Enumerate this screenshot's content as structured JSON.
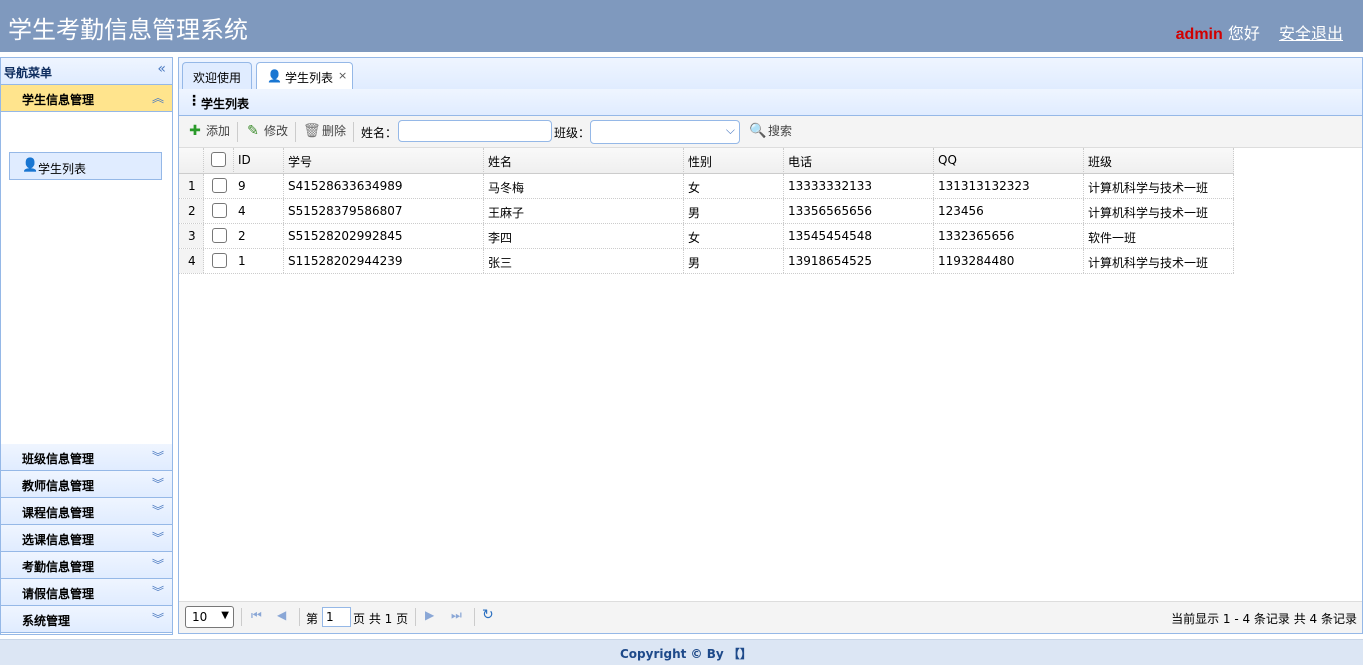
{
  "header": {
    "app_title": "学生考勤信息管理系统",
    "user_name": "admin",
    "greeting": "您好",
    "logout": "安全退出"
  },
  "sidebar": {
    "title": "导航菜单",
    "active_section": "学生信息管理",
    "active_items": [
      {
        "label": "学生列表",
        "icon": "user-icon"
      }
    ],
    "sections": [
      {
        "label": "班级信息管理"
      },
      {
        "label": "教师信息管理"
      },
      {
        "label": "课程信息管理"
      },
      {
        "label": "选课信息管理"
      },
      {
        "label": "考勤信息管理"
      },
      {
        "label": "请假信息管理"
      },
      {
        "label": "系统管理"
      }
    ]
  },
  "tabs": [
    {
      "label": "欢迎使用"
    },
    {
      "label": "学生列表",
      "close": "×"
    }
  ],
  "panel": {
    "title": "学生列表"
  },
  "toolbar": {
    "add": "添加",
    "edit": "修改",
    "delete": "删除",
    "name_label": "姓名：",
    "name_value": "",
    "class_label": "班级：",
    "class_value": "",
    "search": "搜索"
  },
  "table": {
    "columns": [
      "ID",
      "学号",
      "姓名",
      "性别",
      "电话",
      "QQ",
      "班级"
    ],
    "rows": [
      {
        "num": "1",
        "cells": [
          "9",
          "S41528633634989",
          "马冬梅",
          "女",
          "13333332133",
          "131313132323",
          "计算机科学与技术一班"
        ]
      },
      {
        "num": "2",
        "cells": [
          "4",
          "S51528379586807",
          "王麻子",
          "男",
          "13356565656",
          "123456",
          "计算机科学与技术一班"
        ]
      },
      {
        "num": "3",
        "cells": [
          "2",
          "S51528202992845",
          "李四",
          "女",
          "13545454548",
          "1332365656",
          "软件一班"
        ]
      },
      {
        "num": "4",
        "cells": [
          "1",
          "S11528202944239",
          "张三",
          "男",
          "13918654525",
          "1193284480",
          "计算机科学与技术一班"
        ]
      }
    ]
  },
  "pager": {
    "page_size": "10",
    "page_prefix": "第",
    "page_value": "1",
    "page_suffix": "页 共 1 页",
    "info": "当前显示 1 - 4 条记录 共 4 条记录"
  },
  "footer": {
    "copyright": "Copyright © By 【】"
  }
}
